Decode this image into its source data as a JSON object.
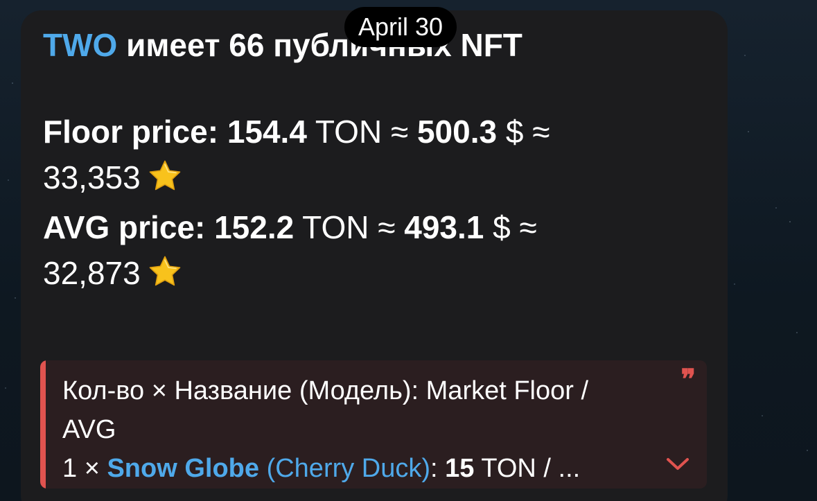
{
  "date_pill": "April 30",
  "title": {
    "tag": "TWO",
    "rest": " имеет 66 публичных NFT"
  },
  "floor": {
    "label": "Floor price:",
    "ton_value": "154.4",
    "ton_unit": "TON ≈",
    "usd_value": "500.3",
    "usd_unit": "$ ≈",
    "stars": "33,353"
  },
  "avg": {
    "label": "AVG price:",
    "ton_value": "152.2",
    "ton_unit": "TON ≈",
    "usd_value": "493.1",
    "usd_unit": "$ ≈",
    "stars": "32,873"
  },
  "quote": {
    "line1": "Кол-во × Название (Модель): Market Floor /",
    "line2": "AVG",
    "item": {
      "qty": "1 ×",
      "name": "Snow Globe",
      "model": "(Cherry Duck)",
      "colon": ":",
      "price": "15",
      "rest": "TON / ..."
    },
    "mark": "❞"
  },
  "icons": {
    "star": "star-emoji-icon",
    "quote": "quote-mark-icon",
    "expand": "chevron-down-icon"
  },
  "colors": {
    "accent": "#4fa9ea",
    "quote_accent": "#e0534f",
    "bubble": "#1c1c1e",
    "quote_bg": "#2b1e20",
    "star": "#f8c21c"
  }
}
